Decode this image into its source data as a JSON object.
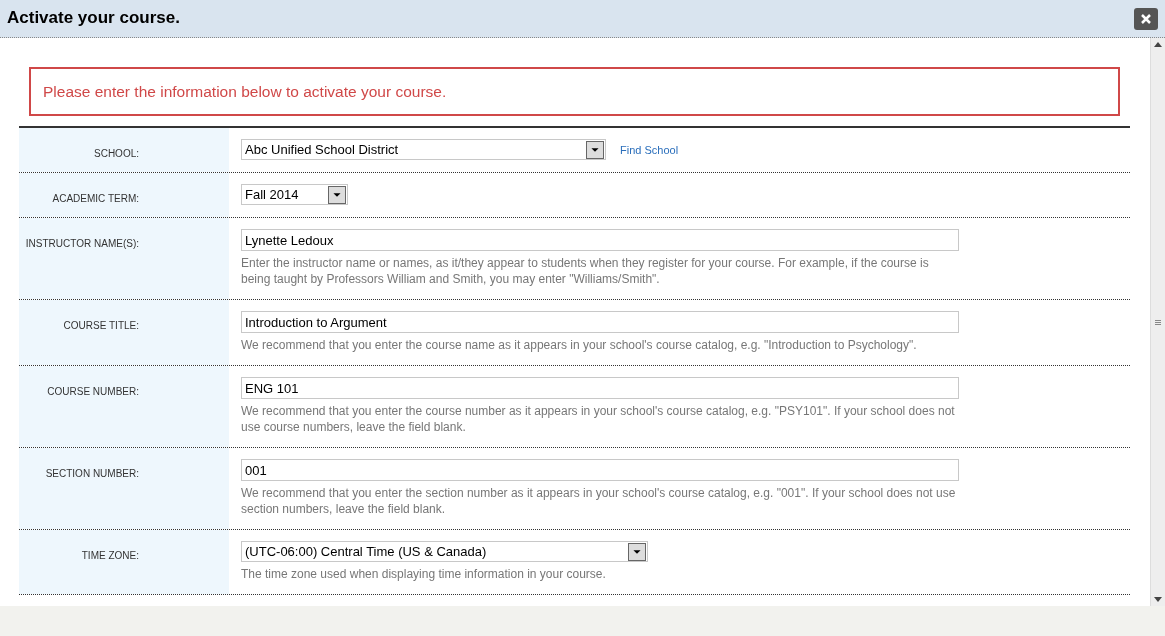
{
  "window": {
    "title": "Activate your course."
  },
  "message": "Please enter the information below to activate your course.",
  "fields": [
    {
      "label": "SCHOOL:",
      "kind": "select",
      "value": "Abc Unified School District",
      "link": "Find School"
    },
    {
      "label": "ACADEMIC TERM:",
      "kind": "select",
      "value": "Fall 2014"
    },
    {
      "label": "INSTRUCTOR NAME(S):",
      "kind": "text",
      "value": "Lynette Ledoux",
      "help": "Enter the instructor name or names, as it/they appear to students when they register for your course. For example, if the course is being taught by Professors William and Smith, you may enter \"Williams/Smith\"."
    },
    {
      "label": "COURSE TITLE:",
      "kind": "text",
      "value": "Introduction to Argument",
      "help": "We recommend that you enter the course name as it appears in your school's course catalog, e.g. \"Introduction to Psychology\"."
    },
    {
      "label": "COURSE NUMBER:",
      "kind": "text",
      "value": "ENG 101",
      "help": "We recommend that you enter the course number as it appears in your school's course catalog, e.g. \"PSY101\". If your school does not use course numbers, leave the field blank."
    },
    {
      "label": "SECTION NUMBER:",
      "kind": "text",
      "value": "001",
      "help": "We recommend that you enter the section number as it appears in your school's course catalog, e.g. \"001\". If your school does not use section numbers, leave the field blank."
    },
    {
      "label": "TIME ZONE:",
      "kind": "select",
      "value": "(UTC-06:00) Central Time (US & Canada)",
      "help": "The time zone used when displaying time information in your course."
    }
  ]
}
